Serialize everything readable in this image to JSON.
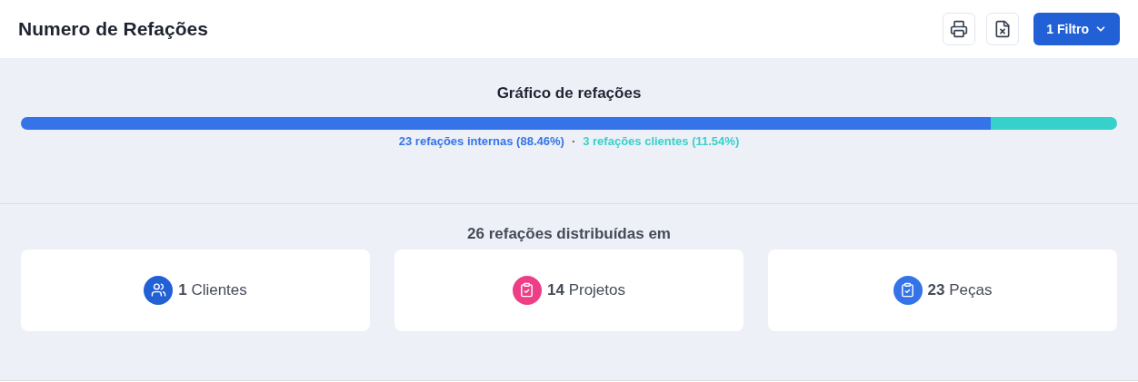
{
  "header": {
    "title": "Numero de Refações",
    "filter_button": "1 Filtro"
  },
  "chart": {
    "title": "Gráfico de refações",
    "segments": [
      {
        "label": "23 refações internas (88.46%)",
        "level": 0.8846,
        "color": "#3474e8"
      },
      {
        "label": "3 refações clientes (11.54%)",
        "level": 0.1154,
        "color": "#36d1cb"
      }
    ],
    "separator": "·"
  },
  "summary": {
    "title": "26 refações distribuídas em",
    "cards": [
      {
        "kind": "clients",
        "text": "**1** Clientes",
        "color": "#2260d6"
      },
      {
        "kind": "projects",
        "text": "**14** Projetos",
        "color": "#ee3e86"
      },
      {
        "kind": "parts",
        "text": "**23** Peças",
        "color": "#3474e8"
      }
    ]
  }
}
